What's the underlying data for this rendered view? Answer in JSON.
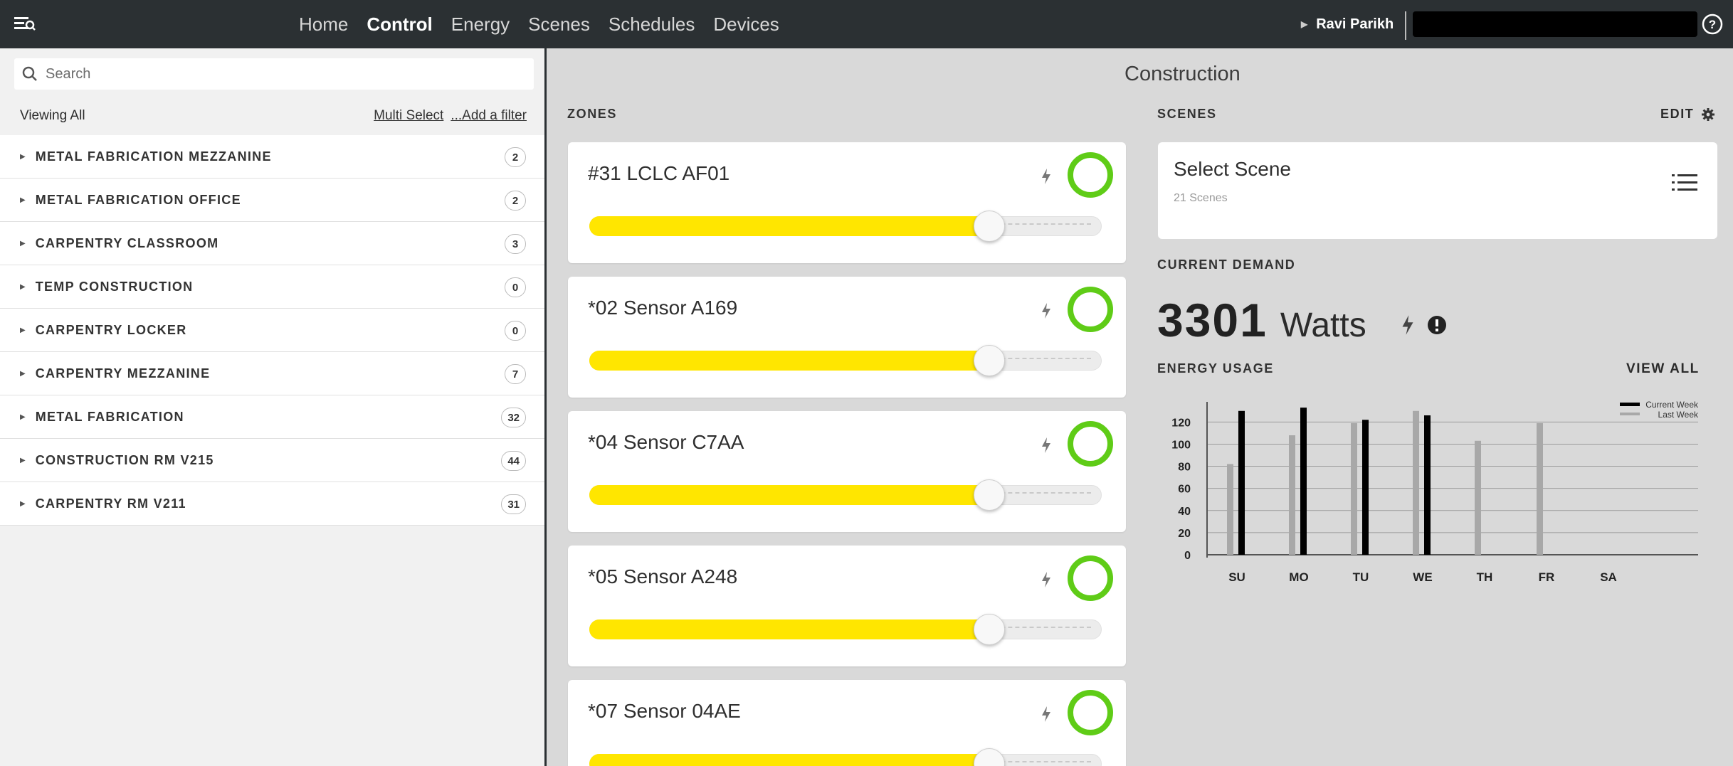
{
  "nav": {
    "items": [
      {
        "label": "Home",
        "active": false
      },
      {
        "label": "Control",
        "active": true
      },
      {
        "label": "Energy",
        "active": false
      },
      {
        "label": "Scenes",
        "active": false
      },
      {
        "label": "Schedules",
        "active": false
      },
      {
        "label": "Devices",
        "active": false
      }
    ],
    "user_name": "Ravi Parikh"
  },
  "sidebar": {
    "search_placeholder": "Search",
    "viewing_label": "Viewing All",
    "multi_select": "Multi Select",
    "add_filter": "...Add a filter",
    "groups": [
      {
        "name": "METAL FABRICATION MEZZANINE",
        "count": "2"
      },
      {
        "name": "METAL FABRICATION OFFICE",
        "count": "2"
      },
      {
        "name": "CARPENTRY CLASSROOM",
        "count": "3"
      },
      {
        "name": "TEMP CONSTRUCTION",
        "count": "0"
      },
      {
        "name": "CARPENTRY LOCKER",
        "count": "0"
      },
      {
        "name": "CARPENTRY MEZZANINE",
        "count": "7"
      },
      {
        "name": "METAL FABRICATION",
        "count": "32"
      },
      {
        "name": "CONSTRUCTION RM V215",
        "count": "44"
      },
      {
        "name": "CARPENTRY RM V211",
        "count": "31"
      }
    ]
  },
  "main": {
    "title": "Construction",
    "zones_label": "ZONES",
    "zones": [
      {
        "name": "#31 LCLC AF01",
        "level": 0.78
      },
      {
        "name": "*02 Sensor A169",
        "level": 0.78
      },
      {
        "name": "*04 Sensor C7AA",
        "level": 0.78
      },
      {
        "name": "*05 Sensor A248",
        "level": 0.78
      },
      {
        "name": "*07 Sensor 04AE",
        "level": 0.78
      }
    ],
    "scenes_label": "SCENES",
    "edit_label": "EDIT",
    "scene_title": "Select Scene",
    "scene_count": "21 Scenes",
    "demand_label": "CURRENT DEMAND",
    "demand_value": "3301",
    "demand_unit": "Watts",
    "energy_label": "ENERGY USAGE",
    "view_all": "VIEW ALL"
  },
  "colors": {
    "topbar": "#2b3033",
    "ring": "#5fcc17",
    "slider_fill": "#ffe600",
    "current_week": "#000000",
    "last_week": "#a8a8a8"
  },
  "chart_data": {
    "type": "bar",
    "categories": [
      "SU",
      "MO",
      "TU",
      "WE",
      "TH",
      "FR",
      "SA"
    ],
    "series": [
      {
        "name": "Last Week",
        "values": [
          82,
          108,
          119,
          130,
          103,
          119,
          null
        ]
      },
      {
        "name": "Current Week",
        "values": [
          130,
          133,
          122,
          126,
          null,
          null,
          null
        ]
      }
    ],
    "yticks": [
      0,
      20,
      40,
      60,
      80,
      100,
      120
    ],
    "ylim": [
      0,
      135
    ],
    "legend": "top-right",
    "grid": true
  }
}
